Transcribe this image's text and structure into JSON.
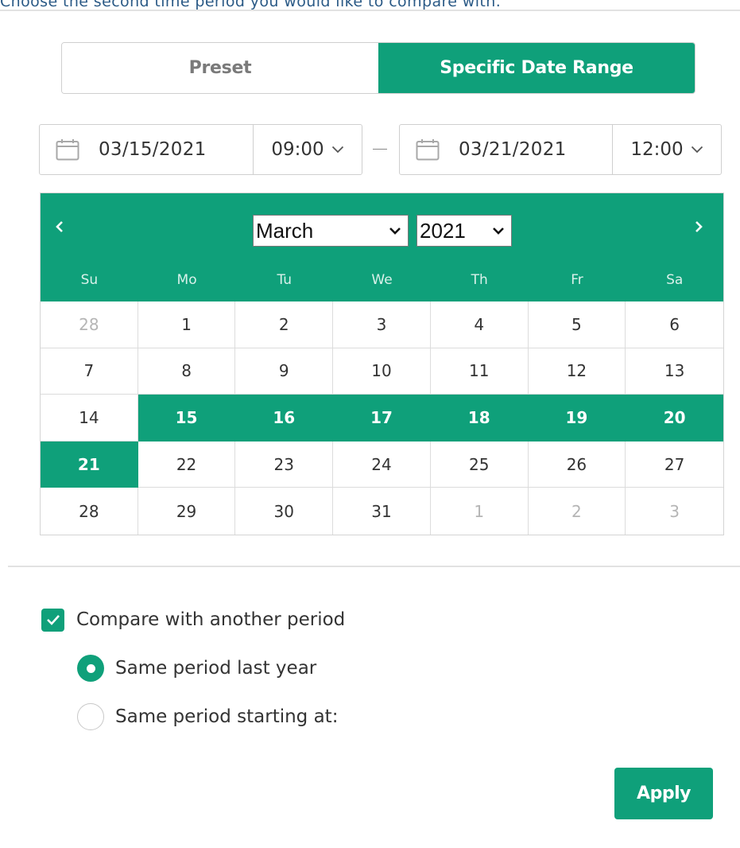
{
  "hint_text": "Choose the second time period you would like to compare with.",
  "mode": {
    "preset_label": "Preset",
    "specific_label": "Specific Date Range",
    "active": "specific"
  },
  "range": {
    "start": {
      "date": "03/15/2021",
      "time": "09:00"
    },
    "end": {
      "date": "03/21/2021",
      "time": "12:00"
    }
  },
  "calendar": {
    "month": "March",
    "year": "2021",
    "weekdays": [
      "Su",
      "Mo",
      "Tu",
      "We",
      "Th",
      "Fr",
      "Sa"
    ],
    "weeks": [
      [
        {
          "d": "28",
          "state": "muted"
        },
        {
          "d": "1"
        },
        {
          "d": "2"
        },
        {
          "d": "3"
        },
        {
          "d": "4"
        },
        {
          "d": "5"
        },
        {
          "d": "6"
        }
      ],
      [
        {
          "d": "7"
        },
        {
          "d": "8"
        },
        {
          "d": "9"
        },
        {
          "d": "10"
        },
        {
          "d": "11"
        },
        {
          "d": "12"
        },
        {
          "d": "13"
        }
      ],
      [
        {
          "d": "14"
        },
        {
          "d": "15",
          "state": "in-range"
        },
        {
          "d": "16",
          "state": "in-range"
        },
        {
          "d": "17",
          "state": "in-range"
        },
        {
          "d": "18",
          "state": "in-range"
        },
        {
          "d": "19",
          "state": "in-range"
        },
        {
          "d": "20",
          "state": "in-range"
        }
      ],
      [
        {
          "d": "21",
          "state": "in-range"
        },
        {
          "d": "22"
        },
        {
          "d": "23"
        },
        {
          "d": "24"
        },
        {
          "d": "25"
        },
        {
          "d": "26"
        },
        {
          "d": "27"
        }
      ],
      [
        {
          "d": "28"
        },
        {
          "d": "29"
        },
        {
          "d": "30"
        },
        {
          "d": "31"
        },
        {
          "d": "1",
          "state": "muted"
        },
        {
          "d": "2",
          "state": "muted"
        },
        {
          "d": "3",
          "state": "muted"
        }
      ]
    ]
  },
  "compare": {
    "checkbox_label": "Compare with another period",
    "checked": true,
    "options": [
      {
        "label": "Same period last year",
        "selected": true
      },
      {
        "label": "Same period starting at:",
        "selected": false
      }
    ]
  },
  "apply_label": "Apply",
  "colors": {
    "accent": "#0fa07a",
    "muted_day": "#b5b5b5",
    "hint": "#2b5a86"
  },
  "icons": [
    "calendar-icon",
    "chevron-down-icon",
    "chevron-left-icon",
    "chevron-right-icon",
    "check-icon"
  ]
}
